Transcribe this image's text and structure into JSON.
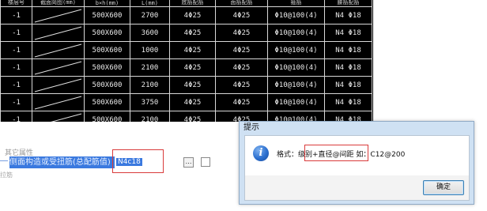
{
  "cad_table": {
    "headers": [
      "楼层号",
      "截面简图(mm)",
      "b×h(mm)",
      "L(mm)",
      "底筋配筋",
      "面筋配筋",
      "箍筋",
      "腰筋配筋"
    ],
    "rows": [
      [
        "-1",
        "",
        "500X600",
        "2700",
        "4Φ25",
        "4Φ25",
        "Φ10@100(4)",
        "N4 Φ18"
      ],
      [
        "-1",
        "",
        "500X600",
        "3600",
        "4Φ25",
        "4Φ25",
        "Φ10@100(4)",
        "N4 Φ18"
      ],
      [
        "-1",
        "",
        "500X600",
        "1000",
        "4Φ25",
        "4Φ25",
        "Φ10@100(4)",
        "N4 Φ18"
      ],
      [
        "-1",
        "",
        "500X600",
        "2100",
        "4Φ25",
        "4Φ25",
        "Φ10@100(4)",
        "N4 Φ18"
      ],
      [
        "-1",
        "",
        "500X600",
        "2100",
        "4Φ25",
        "4Φ25",
        "Φ10@100(4)",
        "N4 Φ18"
      ],
      [
        "-1",
        "",
        "500X600",
        "3750",
        "4Φ25",
        "4Φ25",
        "Φ10@100(4)",
        "N4 Φ18"
      ],
      [
        "-1",
        "",
        "500X600",
        "2100",
        "4Φ25",
        "4Φ25",
        "Φ10@100(4)",
        "N4 Φ18"
      ]
    ]
  },
  "property_panel": {
    "group_label": "其它属性",
    "row_label": "侧面构造或受扭筋(总配筋值)",
    "row_value": "N4c18",
    "ellipsis": "…",
    "next_row": "拉筋"
  },
  "dialog": {
    "title": "提示",
    "message_prefix": "格式：",
    "message_highlight": "级别+直径@间距",
    "message_suffix": "  如：C12@200",
    "ok_button": "确定",
    "icon": "info-icon"
  }
}
